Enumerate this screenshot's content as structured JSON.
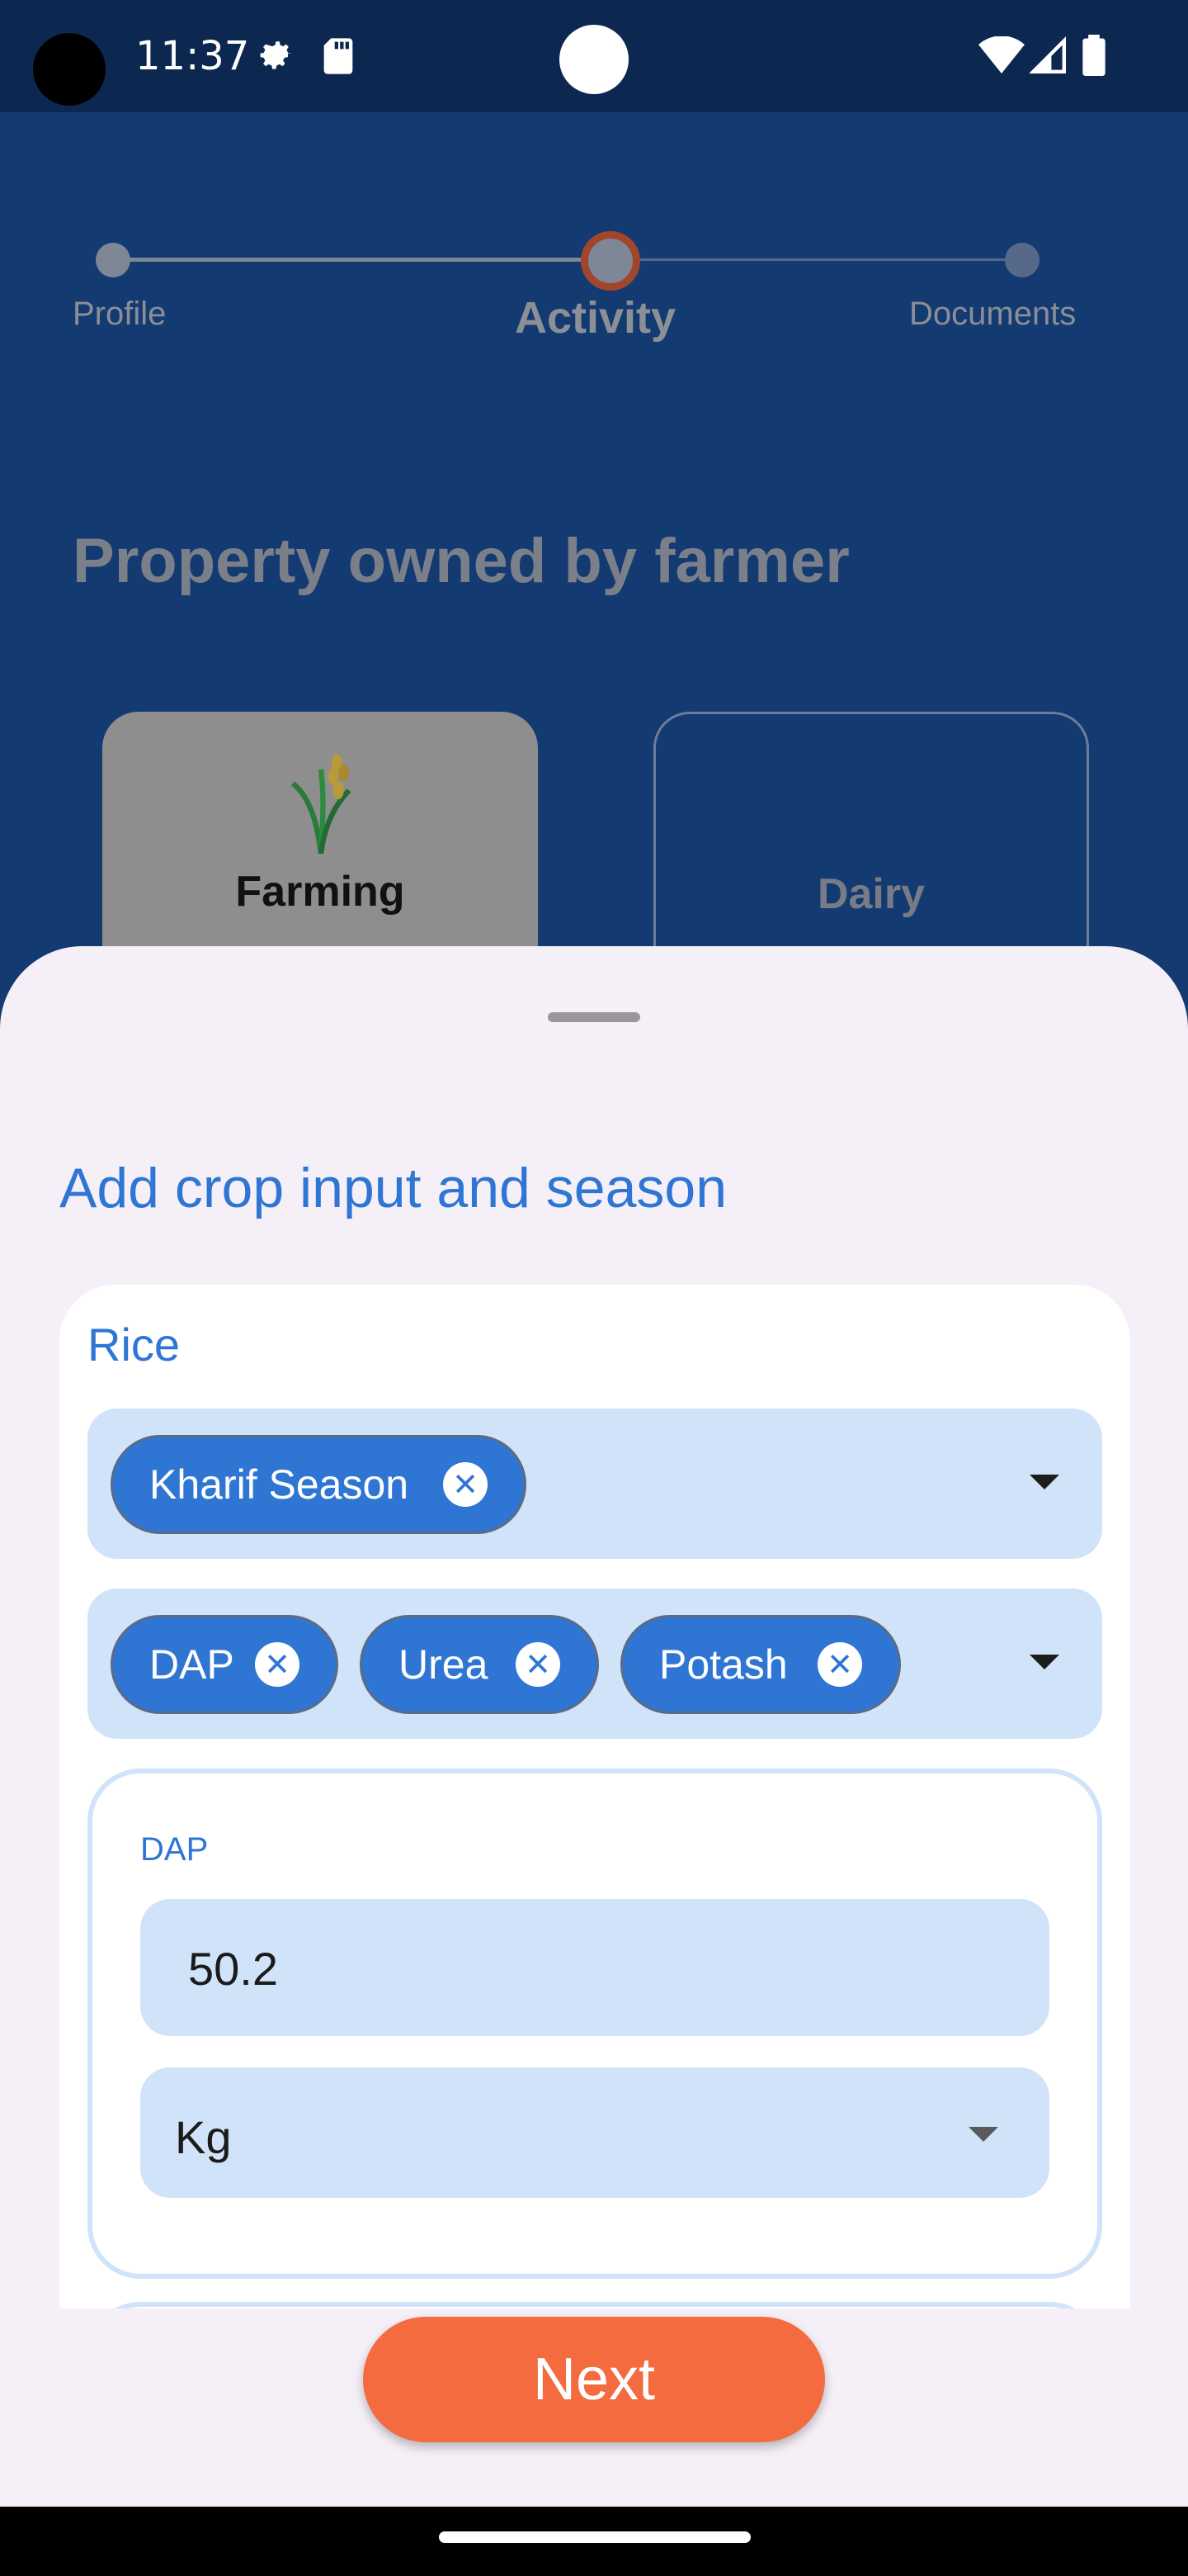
{
  "status_bar": {
    "time": "11:37",
    "icons": [
      "settings-icon",
      "sd-card-icon",
      "wifi-icon",
      "signal-icon",
      "battery-icon"
    ]
  },
  "stepper": {
    "steps": [
      {
        "label": "Profile",
        "state": "done"
      },
      {
        "label": "Activity",
        "state": "active"
      },
      {
        "label": "Documents",
        "state": "pending"
      }
    ]
  },
  "backdrop": {
    "section_title": "Property owned by farmer",
    "categories": [
      {
        "label": "Farming",
        "selected": true,
        "icon": "wheat-icon"
      },
      {
        "label": "Dairy",
        "selected": false
      }
    ]
  },
  "sheet": {
    "title": "Add crop input and season",
    "crop": {
      "name": "Rice",
      "season_chips": [
        "Kharif Season"
      ],
      "input_chips": [
        "DAP",
        "Urea",
        "Potash"
      ],
      "input_detail": {
        "label": "DAP",
        "quantity": "50.2",
        "unit": "Kg"
      }
    },
    "next_label": "Next"
  },
  "colors": {
    "accent": "#2f76d4",
    "chip_bg": "#2f76d4",
    "field_bg": "#d1e3f9",
    "next_button": "#f36b3f",
    "sheet_bg": "#f5eff7"
  }
}
